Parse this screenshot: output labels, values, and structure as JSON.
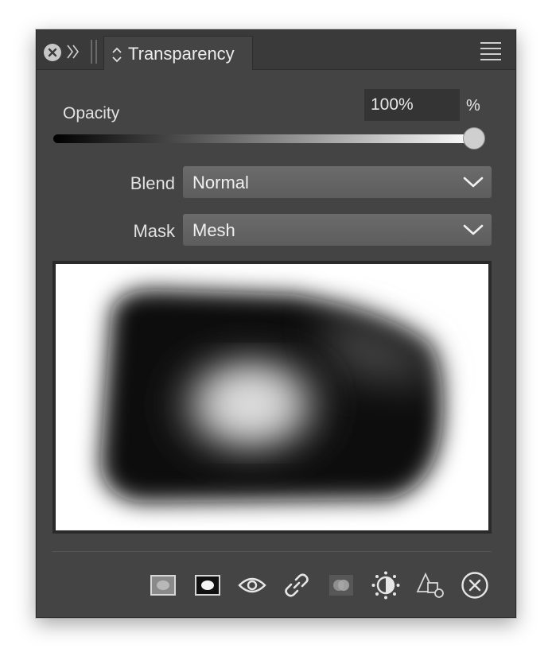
{
  "window": {
    "tab_title": "Transparency",
    "icons": [
      "close-icon",
      "expand-icon",
      "grip-icon",
      "chevron-updown-icon",
      "menu-icon"
    ]
  },
  "opacity": {
    "label": "Opacity",
    "value": "100%",
    "unit": "%",
    "slider_fraction": 1.0
  },
  "blend": {
    "label": "Blend",
    "value": "Normal"
  },
  "mask": {
    "label": "Mask",
    "value": "Mesh"
  },
  "toolbar": {
    "icons": [
      "mask-rect-icon",
      "mask-invert-icon",
      "eye-icon",
      "link-icon",
      "overlap-icon",
      "brightness-icon",
      "shapes-icon",
      "close-circle-icon"
    ]
  }
}
